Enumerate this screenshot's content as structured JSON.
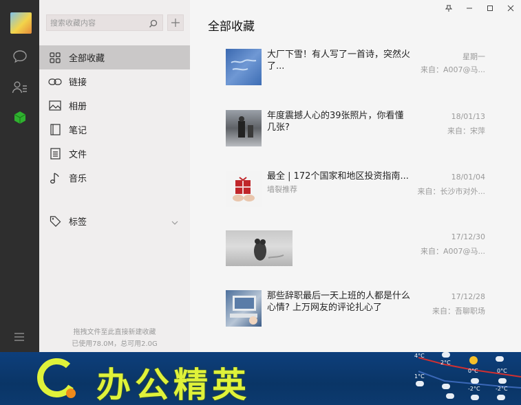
{
  "search": {
    "placeholder": "搜索收藏内容"
  },
  "nav": {
    "items": [
      {
        "label": "全部收藏",
        "icon": "grid-icon"
      },
      {
        "label": "链接",
        "icon": "link-icon"
      },
      {
        "label": "相册",
        "icon": "photo-icon"
      },
      {
        "label": "笔记",
        "icon": "notebook-icon"
      },
      {
        "label": "文件",
        "icon": "file-icon"
      },
      {
        "label": "音乐",
        "icon": "music-icon"
      },
      {
        "label": "标签",
        "icon": "tag-icon"
      }
    ]
  },
  "footer": {
    "hint": "拖拽文件至此直接新建收藏",
    "storage": "已使用78.0M，总可用2.0G"
  },
  "page": {
    "title": "全部收藏"
  },
  "favorites": [
    {
      "title": "大厂下雪！有人写了一首诗，突然火了...",
      "subtitle": "",
      "date": "星期一",
      "source": "来自：A007@马..."
    },
    {
      "title": "年度震撼人心的39张照片，你看懂几张?",
      "subtitle": "",
      "date": "18/01/13",
      "source": "来自：宋萍"
    },
    {
      "title": "最全 | 172个国家和地区投资指南...",
      "subtitle": "墙裂推荐",
      "date": "18/01/04",
      "source": "来自：长沙市对外..."
    },
    {
      "title": "",
      "subtitle": "",
      "date": "17/12/30",
      "source": "来自：A007@马..."
    },
    {
      "title": "那些辞职最后一天上班的人都是什么心情? 上万网友的评论扎心了",
      "subtitle": "",
      "date": "17/12/28",
      "source": "来自：吾聊职场"
    }
  ],
  "banner": {
    "brand": "办公精英",
    "temps": [
      "4°C",
      "2°C",
      "0°C",
      "1°C",
      "0°C",
      "-2°C",
      "-2°C"
    ]
  },
  "colors": {
    "rail": "#2e2e2e",
    "active_icon": "#2fb12f",
    "brand_text": "#dff23a",
    "banner_bg": "#0d3f7c"
  }
}
